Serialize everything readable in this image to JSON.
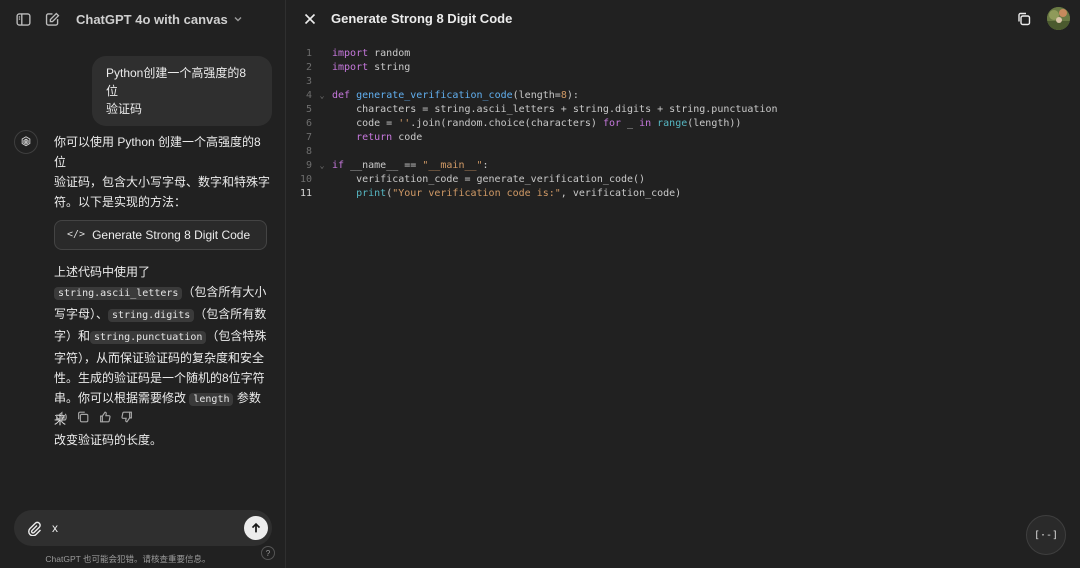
{
  "chat": {
    "model_name": "ChatGPT 4o with canvas",
    "user_message_line1": "Python创建一个高强度的8位",
    "user_message_line2": "验证码",
    "intro_line1": "你可以使用 Python 创建一个高强度的8位",
    "intro_line2": "验证码，包含大小写字母、数字和特殊字",
    "intro_line3": "符。以下是实现的方法：",
    "canvas_chip_icon": "</>",
    "canvas_chip_label": "Generate Strong 8 Digit Code",
    "explain": {
      "l1": "上述代码中使用了",
      "code1": "string.ascii_letters",
      "t1": "（包含所有大小",
      "l3": "写字母）、",
      "code2": "string.digits",
      "t2": "（包含所有数",
      "l4": "字）和",
      "code3": "string.punctuation",
      "t3": "（包含特殊",
      "l5": "字符），从而保证验证码的复杂度和安全",
      "l6": "性。生成的验证码是一个随机的8位字符",
      "l7": "串。你可以根据需要修改",
      "code4": "length",
      "t4": "参数来",
      "l8": "改变验证码的长度。"
    },
    "composer_value": "x",
    "disclaimer": "ChatGPT 也可能会犯错。请核查重要信息。",
    "help_label": "?"
  },
  "canvas": {
    "title": "Generate Strong 8 Digit Code",
    "fab_label": "[·-]",
    "lines": [
      {
        "n": "1",
        "fold": ""
      },
      {
        "n": "2",
        "fold": ""
      },
      {
        "n": "3",
        "fold": ""
      },
      {
        "n": "4",
        "fold": "⌄"
      },
      {
        "n": "5",
        "fold": ""
      },
      {
        "n": "6",
        "fold": ""
      },
      {
        "n": "7",
        "fold": ""
      },
      {
        "n": "8",
        "fold": ""
      },
      {
        "n": "9",
        "fold": "⌄"
      },
      {
        "n": "10",
        "fold": ""
      },
      {
        "n": "11",
        "fold": ""
      }
    ],
    "code": {
      "l1_kw": "import",
      "l1_rest": " random",
      "l2_kw": "import",
      "l2_rest": " string",
      "l4_kw": "def",
      "l4_fn": "generate_verification_code",
      "l4_a": "(length=",
      "l4_num": "8",
      "l4_b": "):",
      "l5": "    characters = string.ascii_letters + string.digits + string.punctuation",
      "l6_a": "    code = ",
      "l6_str": "''",
      "l6_b": ".join(random.choice(characters) ",
      "l6_kw": "for",
      "l6_c": " _ ",
      "l6_kw2": "in",
      "l6_d": " ",
      "l6_bi": "range",
      "l6_e": "(length))",
      "l7_kw": "    return",
      "l7_rest": " code",
      "l9_kw": "if",
      "l9_a": " __name__ == ",
      "l9_str": "\"__main__\"",
      "l9_b": ":",
      "l10": "    verification_code = generate_verification_code()",
      "l11_bi": "    print",
      "l11_a": "(",
      "l11_str": "\"Your verification code is:\"",
      "l11_b": ", verification_code)"
    }
  },
  "colors": {
    "background": "#212121",
    "bubble": "#2f2f2f",
    "keyword": "#c678dd",
    "string": "#d19a66",
    "function": "#61afef"
  }
}
